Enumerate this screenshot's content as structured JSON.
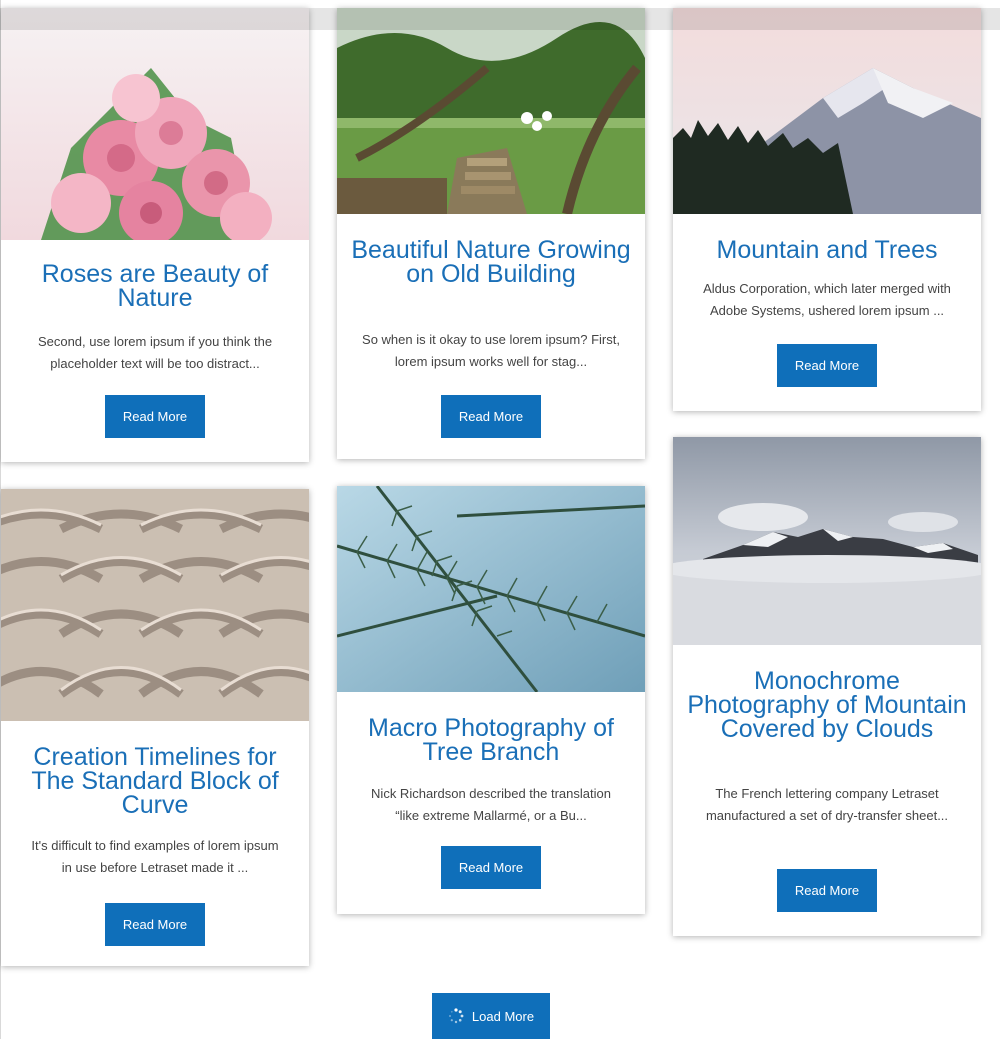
{
  "posts": [
    {
      "title": "Roses are Beauty of Nature",
      "excerpt": "Second, use lorem ipsum if you think the placeholder text will be too distract...",
      "button": "Read More",
      "image": "pink-roses-bouquet"
    },
    {
      "title": "Beautiful Nature Growing on Old Building",
      "excerpt": "So when is it okay to use lorem ipsum? First, lorem ipsum works well for stag...",
      "button": "Read More",
      "image": "overgrown-garden-steps"
    },
    {
      "title": "Mountain and Trees",
      "excerpt": "Aldus Corporation, which later merged with Adobe Systems, ushered lorem ipsum ...",
      "button": "Read More",
      "image": "snowy-mountain-pine-trees"
    },
    {
      "title": "Creation Timelines for The Standard Block of Curve",
      "excerpt": "It's difficult to find examples of lorem ipsum in use before Letraset made it ...",
      "button": "Read More",
      "image": "curved-concrete-blocks"
    },
    {
      "title": "Macro Photography of Tree Branch",
      "excerpt": "Nick Richardson described the translation “like extreme Mallarmé, or a Bu...",
      "button": "Read More",
      "image": "pine-branch-macro"
    },
    {
      "title": "Monochrome Photography of Mountain Covered by Clouds",
      "excerpt": "The French lettering company Letraset manufactured a set of dry-transfer sheet...",
      "button": "Read More",
      "image": "mountain-above-clouds"
    }
  ],
  "load_more": {
    "label": "Load More",
    "icon": "spinner-icon"
  },
  "colors": {
    "accent": "#0f6fba",
    "title": "#1a6fb7",
    "text": "#444444"
  }
}
